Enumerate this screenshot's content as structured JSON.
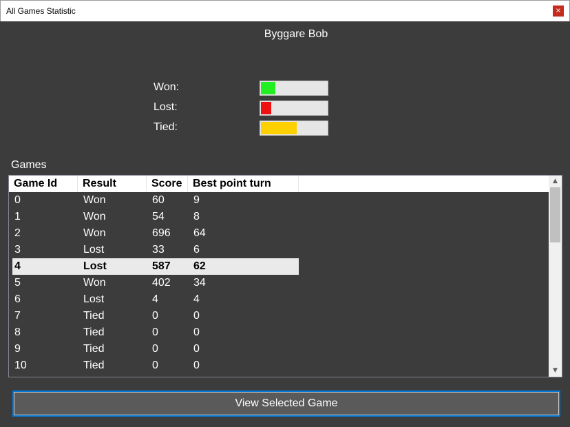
{
  "window": {
    "title": "All Games Statistic",
    "close_glyph": "×"
  },
  "player": {
    "name": "Byggare Bob"
  },
  "stats": {
    "won": {
      "label": "Won:",
      "fraction": 0.22,
      "color": "#22ee22"
    },
    "lost": {
      "label": "Lost:",
      "fraction": 0.16,
      "color": "#ee1111"
    },
    "tied": {
      "label": "Tied:",
      "fraction": 0.54,
      "color": "#ffd000"
    }
  },
  "games": {
    "label": "Games",
    "columns": [
      "Game Id",
      "Result",
      "Score",
      "Best point turn"
    ],
    "rows": [
      [
        "0",
        "Won",
        "60",
        "9"
      ],
      [
        "1",
        "Won",
        "54",
        "8"
      ],
      [
        "2",
        "Won",
        "696",
        "64"
      ],
      [
        "3",
        "Lost",
        "33",
        "6"
      ],
      [
        "4",
        "Lost",
        "587",
        "62"
      ],
      [
        "5",
        "Won",
        "402",
        "34"
      ],
      [
        "6",
        "Lost",
        "4",
        "4"
      ],
      [
        "7",
        "Tied",
        "0",
        "0"
      ],
      [
        "8",
        "Tied",
        "0",
        "0"
      ],
      [
        "9",
        "Tied",
        "0",
        "0"
      ],
      [
        "10",
        "Tied",
        "0",
        "0"
      ]
    ],
    "selected_index": 4
  },
  "scroll_icons": {
    "up": "chevron-up-icon",
    "down": "chevron-down-icon"
  },
  "buttons": {
    "view_selected": "View Selected Game"
  }
}
